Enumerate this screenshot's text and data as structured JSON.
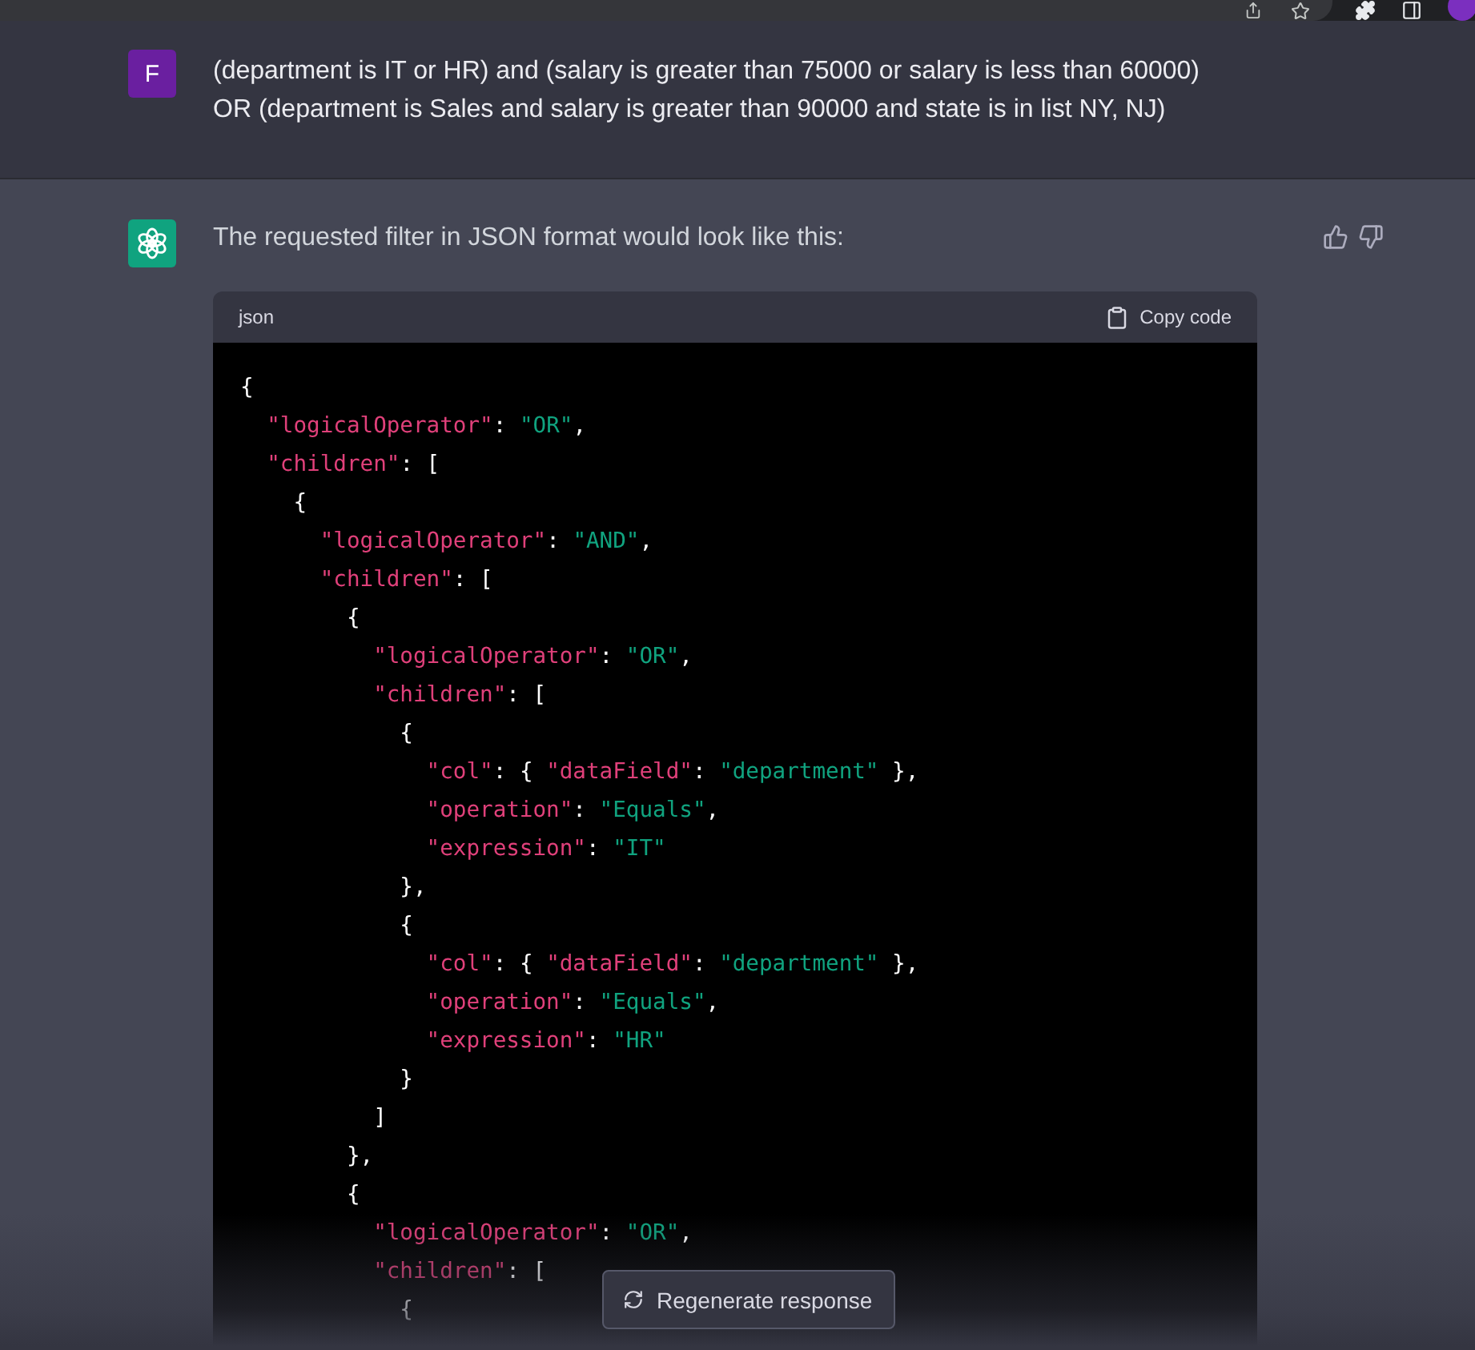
{
  "user_message": {
    "avatar": "F",
    "lines": [
      "(department is IT or HR) and (salary is greater than 75000 or salary is less than 60000)",
      "OR (department is Sales and salary is greater than 90000 and state is in list NY, NJ)"
    ]
  },
  "assistant_message": {
    "text": "The requested filter in JSON format would look like this:",
    "code_block": {
      "language": "json",
      "copy_label": "Copy code",
      "lines": [
        [
          {
            "kind": "p",
            "text": "{"
          }
        ],
        [
          {
            "kind": "key",
            "text": "  \"logicalOperator\""
          },
          {
            "kind": "p",
            "text": ": "
          },
          {
            "kind": "str",
            "text": "\"OR\""
          },
          {
            "kind": "p",
            "text": ","
          }
        ],
        [
          {
            "kind": "key",
            "text": "  \"children\""
          },
          {
            "kind": "p",
            "text": ": ["
          }
        ],
        [
          {
            "kind": "p",
            "text": "    {"
          }
        ],
        [
          {
            "kind": "key",
            "text": "      \"logicalOperator\""
          },
          {
            "kind": "p",
            "text": ": "
          },
          {
            "kind": "str",
            "text": "\"AND\""
          },
          {
            "kind": "p",
            "text": ","
          }
        ],
        [
          {
            "kind": "key",
            "text": "      \"children\""
          },
          {
            "kind": "p",
            "text": ": ["
          }
        ],
        [
          {
            "kind": "p",
            "text": "        {"
          }
        ],
        [
          {
            "kind": "key",
            "text": "          \"logicalOperator\""
          },
          {
            "kind": "p",
            "text": ": "
          },
          {
            "kind": "str",
            "text": "\"OR\""
          },
          {
            "kind": "p",
            "text": ","
          }
        ],
        [
          {
            "kind": "key",
            "text": "          \"children\""
          },
          {
            "kind": "p",
            "text": ": ["
          }
        ],
        [
          {
            "kind": "p",
            "text": "            {"
          }
        ],
        [
          {
            "kind": "key",
            "text": "              \"col\""
          },
          {
            "kind": "p",
            "text": ": { "
          },
          {
            "kind": "key",
            "text": "\"dataField\""
          },
          {
            "kind": "p",
            "text": ": "
          },
          {
            "kind": "str",
            "text": "\"department\""
          },
          {
            "kind": "p",
            "text": " },"
          }
        ],
        [
          {
            "kind": "key",
            "text": "              \"operation\""
          },
          {
            "kind": "p",
            "text": ": "
          },
          {
            "kind": "str",
            "text": "\"Equals\""
          },
          {
            "kind": "p",
            "text": ","
          }
        ],
        [
          {
            "kind": "key",
            "text": "              \"expression\""
          },
          {
            "kind": "p",
            "text": ": "
          },
          {
            "kind": "str",
            "text": "\"IT\""
          }
        ],
        [
          {
            "kind": "p",
            "text": "            },"
          }
        ],
        [
          {
            "kind": "p",
            "text": "            {"
          }
        ],
        [
          {
            "kind": "key",
            "text": "              \"col\""
          },
          {
            "kind": "p",
            "text": ": { "
          },
          {
            "kind": "key",
            "text": "\"dataField\""
          },
          {
            "kind": "p",
            "text": ": "
          },
          {
            "kind": "str",
            "text": "\"department\""
          },
          {
            "kind": "p",
            "text": " },"
          }
        ],
        [
          {
            "kind": "key",
            "text": "              \"operation\""
          },
          {
            "kind": "p",
            "text": ": "
          },
          {
            "kind": "str",
            "text": "\"Equals\""
          },
          {
            "kind": "p",
            "text": ","
          }
        ],
        [
          {
            "kind": "key",
            "text": "              \"expression\""
          },
          {
            "kind": "p",
            "text": ": "
          },
          {
            "kind": "str",
            "text": "\"HR\""
          }
        ],
        [
          {
            "kind": "p",
            "text": "            }"
          }
        ],
        [
          {
            "kind": "p",
            "text": "          ]"
          }
        ],
        [
          {
            "kind": "p",
            "text": "        },"
          }
        ],
        [
          {
            "kind": "p",
            "text": "        {"
          }
        ],
        [
          {
            "kind": "key",
            "text": "          \"logicalOperator\""
          },
          {
            "kind": "p",
            "text": ": "
          },
          {
            "kind": "str",
            "text": "\"OR\""
          },
          {
            "kind": "p",
            "text": ","
          }
        ],
        [
          {
            "kind": "key",
            "text": "          \"children\""
          },
          {
            "kind": "p",
            "text": ": ["
          }
        ],
        [
          {
            "kind": "p",
            "text": "            {"
          }
        ]
      ]
    }
  },
  "regenerate_button": {
    "label": "Regenerate response"
  }
}
